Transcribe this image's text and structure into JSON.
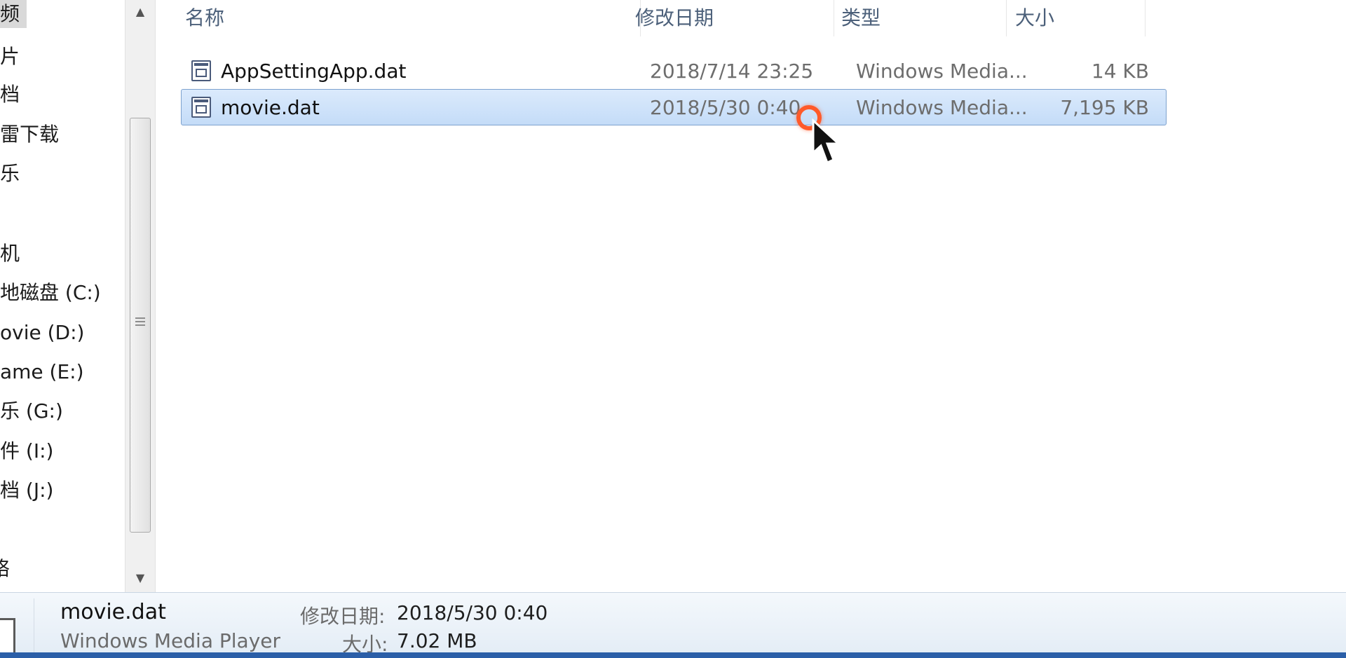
{
  "nav": {
    "items": [
      {
        "label": "频",
        "selected": true
      },
      {
        "label": "片"
      },
      {
        "label": "档"
      },
      {
        "label": "雷下载"
      },
      {
        "label": "乐"
      },
      {
        "label": "机"
      },
      {
        "label": "地磁盘 (C:)"
      },
      {
        "label": "ovie (D:)"
      },
      {
        "label": "ame (E:)"
      },
      {
        "label": "乐 (G:)"
      },
      {
        "label": "件 (I:)"
      },
      {
        "label": "档 (J:)"
      },
      {
        "label": "络"
      }
    ],
    "scroll_up": "▲",
    "scroll_down": "▼"
  },
  "columns": {
    "name": "名称",
    "date": "修改日期",
    "type": "类型",
    "size": "大小"
  },
  "files": [
    {
      "name": "AppSettingApp.dat",
      "date": "2018/7/14 23:25",
      "type": "Windows Media...",
      "size": "14 KB",
      "selected": false
    },
    {
      "name": "movie.dat",
      "date": "2018/5/30 0:40",
      "type": "Windows Media...",
      "size": "7,195 KB",
      "selected": true
    }
  ],
  "details": {
    "name": "movie.dat",
    "type": "Windows Media Player",
    "date_label": "修改日期:",
    "date_value": "2018/5/30 0:40",
    "size_label": "大小:",
    "size_value": "7.02 MB"
  },
  "colors": {
    "selection": "#c4dcf8",
    "selection_border": "#7da2ce",
    "cursor_ring": "#ff5a2a",
    "header_text": "#4c607a"
  }
}
